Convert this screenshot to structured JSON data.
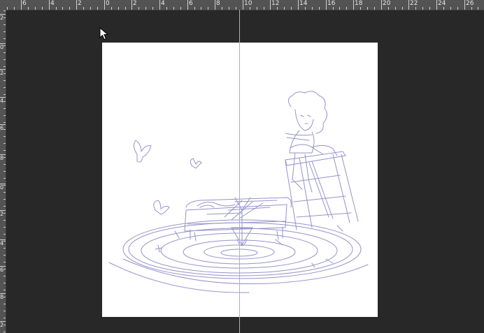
{
  "ruler": {
    "top_labels": [
      "6",
      "4",
      "2",
      "0",
      "2",
      "4",
      "6",
      "8",
      "10",
      "12",
      "14",
      "16",
      "18",
      "20",
      "22",
      "24",
      "26"
    ],
    "left_labels": [
      "2",
      "0",
      "2",
      "4",
      "6",
      "8",
      "0",
      "2",
      "4",
      "6",
      "8",
      "2"
    ]
  },
  "colors": {
    "workspace": "#282828",
    "ruler": "#535353",
    "canvas": "#ffffff",
    "guide": "#2ee6f0",
    "sketch_stroke": "#8a87c4"
  },
  "document": {
    "content": "pencil sketch illustration"
  }
}
